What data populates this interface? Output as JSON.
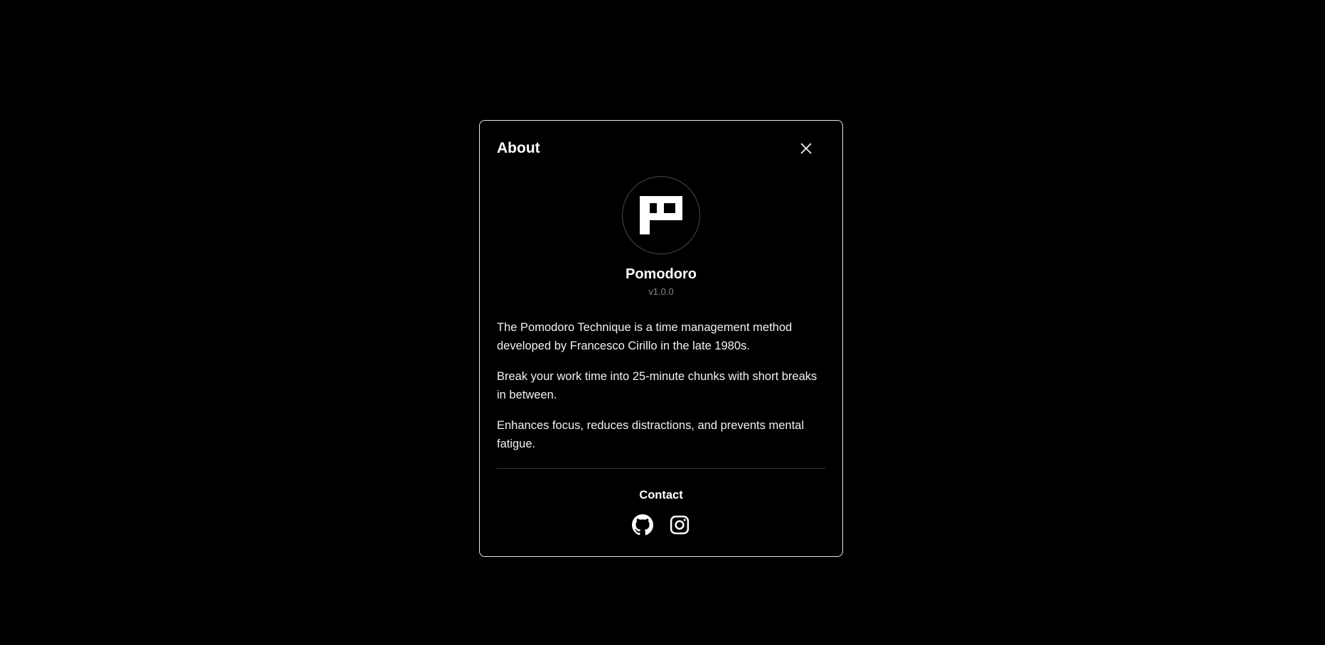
{
  "dialog": {
    "title": "About",
    "close_icon": "close-icon"
  },
  "app": {
    "logo_icon": "pomodoro-logo-icon",
    "name": "Pomodoro",
    "version": "v1.0.0"
  },
  "description": [
    "The Pomodoro Technique is a time management method developed by Francesco Cirillo in the late 1980s.",
    "Break your work time into 25-minute chunks with short breaks in between.",
    "Enhances focus, reduces distractions, and prevents mental fatigue."
  ],
  "contact": {
    "title": "Contact",
    "links": [
      {
        "icon": "github-icon"
      },
      {
        "icon": "instagram-icon"
      }
    ]
  },
  "colors": {
    "background": "#000000",
    "text": "#ffffff",
    "muted": "#8a8a8a",
    "border": "#e6e6e6",
    "divider": "#2a3348"
  }
}
